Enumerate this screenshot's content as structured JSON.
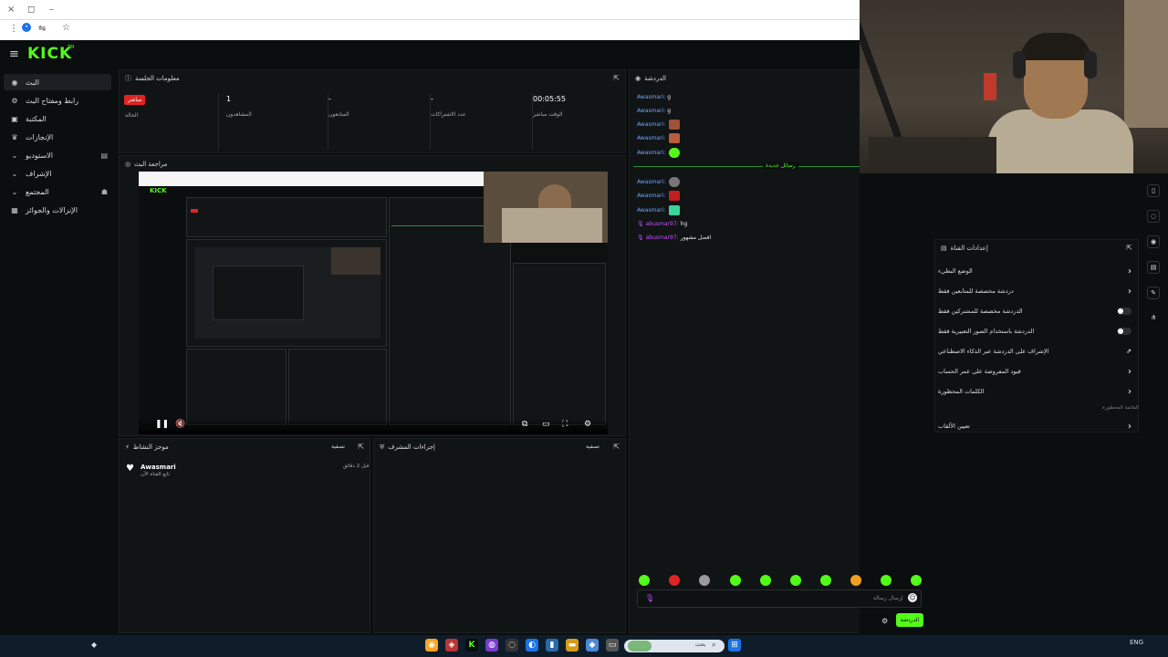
{
  "kick_logo": "KICK",
  "kick_logo_sup": "TM",
  "sidebar": {
    "items": [
      {
        "label": "البث",
        "icon": "broadcast-icon"
      },
      {
        "label": "رابط ومفتاح البث",
        "icon": "key-icon"
      },
      {
        "label": "المكتبة",
        "icon": "library-icon"
      },
      {
        "label": "الإنجازات",
        "icon": "trophy-icon"
      },
      {
        "label": "الاستوديو",
        "icon": "studio-icon"
      },
      {
        "label": "الإشراف",
        "icon": "shield-icon"
      },
      {
        "label": "المجتمع",
        "icon": "community-icon"
      },
      {
        "label": "الإنزالات والجوائز",
        "icon": "gift-icon"
      }
    ]
  },
  "session": {
    "title": "معلومات الجلسة",
    "live_badge": "مباشر",
    "live_label": "الحالة",
    "stats": [
      {
        "value": "1",
        "label": "المشاهدون"
      },
      {
        "value": "-",
        "label": "المتابعون"
      },
      {
        "value": "-",
        "label": "عدد الاشتراكات"
      },
      {
        "value": "00:05:55",
        "label": "الوقت مباشر"
      }
    ]
  },
  "preview": {
    "title": "مراجعة البث"
  },
  "activity": {
    "title": "موجز النشاط",
    "filter": "تصفية",
    "item_user": "Awasmari",
    "item_action": "تابع القناة الآن",
    "item_time": "قبل 2 دقائق"
  },
  "mod": {
    "title": "إجراءات المشرف",
    "filter": "تصفية"
  },
  "chat": {
    "title": "الدردشة",
    "new_messages": "رسائل جديدة",
    "lines": [
      {
        "user": "Awasmari:",
        "text": "g"
      },
      {
        "user": "Awasmari:",
        "text": "g"
      },
      {
        "user": "Awasmari:",
        "text": ""
      },
      {
        "user": "Awasmari:",
        "text": ""
      },
      {
        "user": "Awasmari:",
        "text": ""
      },
      {
        "user": "Awasmari:",
        "text": ""
      },
      {
        "user": "Awasmari:",
        "text": ""
      },
      {
        "user": "Awasmari:",
        "text": ""
      },
      {
        "user": "abusmar97:",
        "text": "hg"
      },
      {
        "user": "abusmar97:",
        "text": "افضل مشهور"
      }
    ],
    "input_placeholder": "إرسال رسالة",
    "send_label": "الدردشة"
  },
  "settings": {
    "title": "إعدادات القناة",
    "rows": [
      {
        "label": "الوضع البطيء",
        "kind": "chevron"
      },
      {
        "label": "دردشة مخصصة للمتابعين فقط",
        "kind": "chevron"
      },
      {
        "label": "الدردشة مخصصة للمشتركين فقط",
        "kind": "toggle"
      },
      {
        "label": "الدردشة باستخدام الصور التعبيرية فقط",
        "kind": "toggle"
      },
      {
        "label": "الإشراف على الدردشة عبر الذكاء الاصطناعي",
        "kind": "external"
      },
      {
        "label": "قيود المفروضة على عمر الحساب",
        "kind": "chevron"
      },
      {
        "label": "الكلمات المحظورة",
        "kind": "chevron"
      }
    ],
    "section_label": "القائمة المحظورة",
    "ban_row": "تعيين الألقاب"
  },
  "taskbar": {
    "search_label": "بحث"
  },
  "colors": {
    "kick_green": "#53fc18",
    "live_red": "#e22323",
    "chat_user_blue": "#6ea7ff",
    "chat_user_purple": "#c44fff"
  }
}
